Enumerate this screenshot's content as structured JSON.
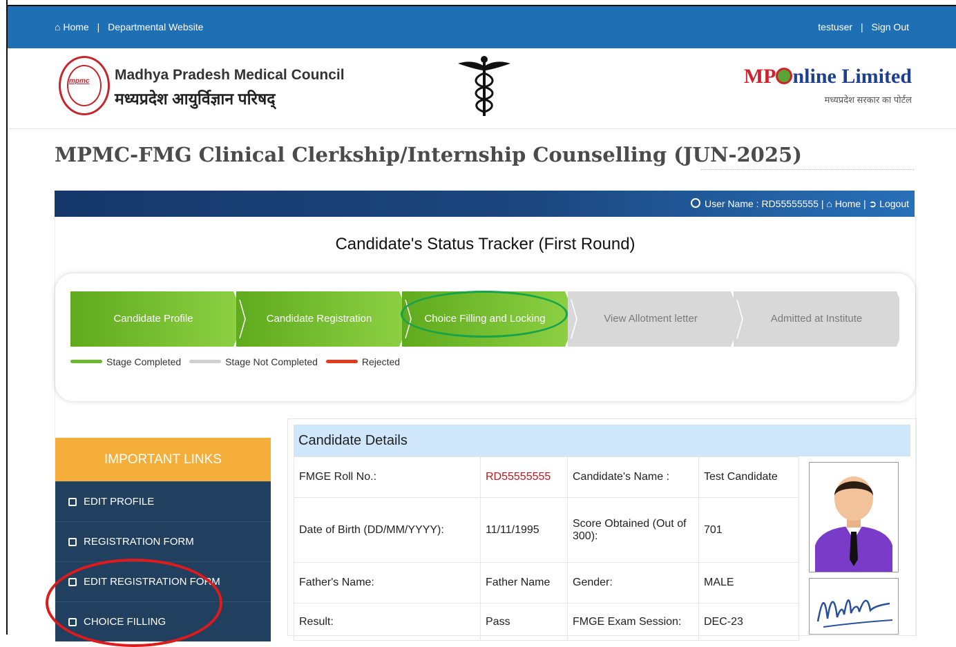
{
  "topbar": {
    "home": "Home",
    "departmental": "Departmental Website",
    "user": "testuser",
    "signout": "Sign Out"
  },
  "header": {
    "seal_text": "mpmc",
    "council_en": "Madhya Pradesh Medical Council",
    "council_hi": "मध्यप्रदेश आयुर्विज्ञान परिषद्",
    "partner_mp": "MP",
    "partner_rest": "nline Limited",
    "partner_sub": "मध्यप्रदेश सरकार का पोर्टल"
  },
  "page": {
    "title": "MPMC-FMG Clinical Clerkship/Internship Counselling (JUN-2025)"
  },
  "userbar": {
    "username": "User Name : RD55555555",
    "home": "Home",
    "logout": "Logout"
  },
  "tracker": {
    "title": "Candidate's Status Tracker (First Round)",
    "steps": [
      {
        "label": "Candidate Profile",
        "status": "completed"
      },
      {
        "label": "Candidate Registration",
        "status": "completed"
      },
      {
        "label": "Choice Filling and Locking",
        "status": "completed"
      },
      {
        "label": "View Allotment letter",
        "status": "not_completed"
      },
      {
        "label": "Admitted at Institute",
        "status": "not_completed"
      }
    ],
    "legend": [
      {
        "label": "Stage Completed",
        "color": "#6ab82b"
      },
      {
        "label": "Stage Not Completed",
        "color": "#d0d0d0"
      },
      {
        "label": "Rejected",
        "color": "#e23a1e"
      }
    ]
  },
  "sidebar": {
    "title": "IMPORTANT LINKS",
    "items": [
      {
        "label": "EDIT PROFILE",
        "icon": "edit-icon"
      },
      {
        "label": "REGISTRATION FORM",
        "icon": "id-card-icon"
      },
      {
        "label": "EDIT REGISTRATION FORM",
        "icon": "edit-icon"
      },
      {
        "label": "CHOICE FILLING",
        "icon": "check-square-icon"
      }
    ]
  },
  "details": {
    "title": "Candidate Details",
    "rows": [
      {
        "l1": "FMGE Roll No.:",
        "v1": "RD55555555",
        "l2": "Candidate's Name :",
        "v2": "Test Candidate"
      },
      {
        "l1": "Date of Birth (DD/MM/YYYY):",
        "v1": "11/11/1995",
        "l2": "Score Obtained (Out of 300):",
        "v2": "701"
      },
      {
        "l1": "Father's Name:",
        "v1": "Father Name",
        "l2": "Gender:",
        "v2": "MALE"
      },
      {
        "l1": "Result:",
        "v1": "Pass",
        "l2": "FMGE Exam Session:",
        "v2": "DEC-23"
      }
    ]
  },
  "colors": {
    "topbar": "#1f6fb4",
    "completed": "#6ab82b",
    "sidebar_head": "#f6ae3a",
    "sidebar_item": "#213f5f",
    "roll_no": "#c0171f"
  }
}
